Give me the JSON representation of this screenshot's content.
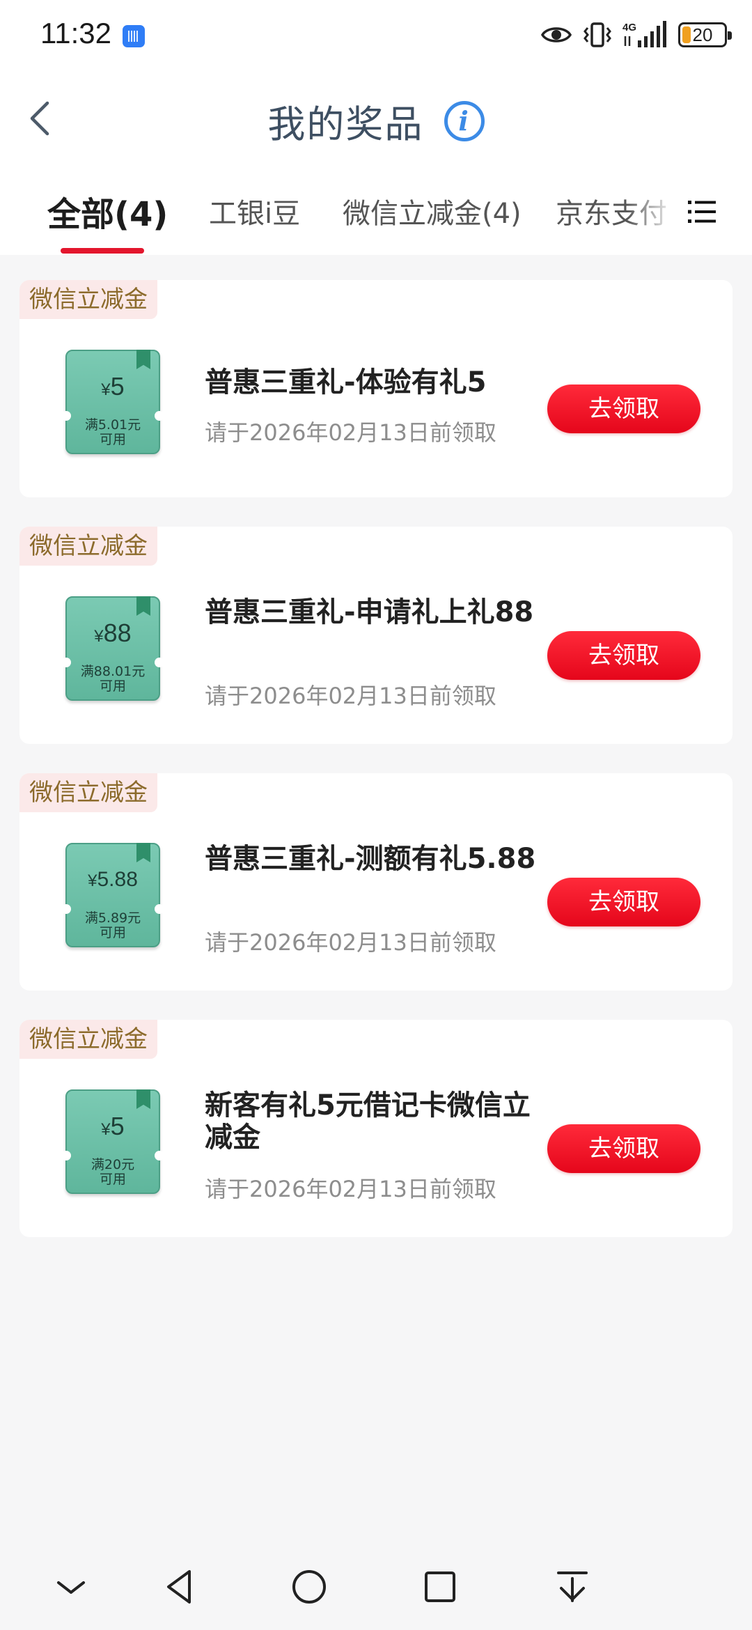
{
  "status_bar": {
    "time": "11:32",
    "network": "4G",
    "battery": "20",
    "icons": [
      "voice-app-icon",
      "eye-icon",
      "vibrate-icon",
      "signal-icon",
      "battery-icon"
    ]
  },
  "header": {
    "title": "我的奖品",
    "info_icon_glyph": "i"
  },
  "tabs": [
    {
      "label": "全部(4)",
      "active": true
    },
    {
      "label": "工银i豆",
      "active": false
    },
    {
      "label": "微信立减金(4)",
      "active": false
    },
    {
      "label": "京东支付",
      "active": false
    }
  ],
  "colors": {
    "accent_red": "#e5061b",
    "coupon_green": "#6cc0a8",
    "tag_bg": "#fbe9e9",
    "tag_text": "#8c6b2c"
  },
  "prizes": [
    {
      "tag": "微信立减金",
      "amount": "5",
      "currency": "¥",
      "condition_line1": "满5.01元",
      "condition_line2": "可用",
      "name": "普惠三重礼-体验有礼5",
      "deadline": "请于2026年02月13日前领取",
      "button": "去领取"
    },
    {
      "tag": "微信立减金",
      "amount": "88",
      "currency": "¥",
      "condition_line1": "满88.01元",
      "condition_line2": "可用",
      "name": "普惠三重礼-申请礼上礼88",
      "deadline": "请于2026年02月13日前领取",
      "button": "去领取"
    },
    {
      "tag": "微信立减金",
      "amount": "5.88",
      "currency": "¥",
      "condition_line1": "满5.89元",
      "condition_line2": "可用",
      "name": "普惠三重礼-测额有礼5.88",
      "deadline": "请于2026年02月13日前领取",
      "button": "去领取"
    },
    {
      "tag": "微信立减金",
      "amount": "5",
      "currency": "¥",
      "condition_line1": "满20元",
      "condition_line2": "可用",
      "name": "新客有礼5元借记卡微信立减金",
      "deadline": "请于2026年02月13日前领取",
      "button": "去领取"
    }
  ],
  "nav_bar": {
    "items": [
      "collapse-icon",
      "back-icon",
      "home-icon",
      "recents-icon",
      "pull-down-icon"
    ]
  }
}
